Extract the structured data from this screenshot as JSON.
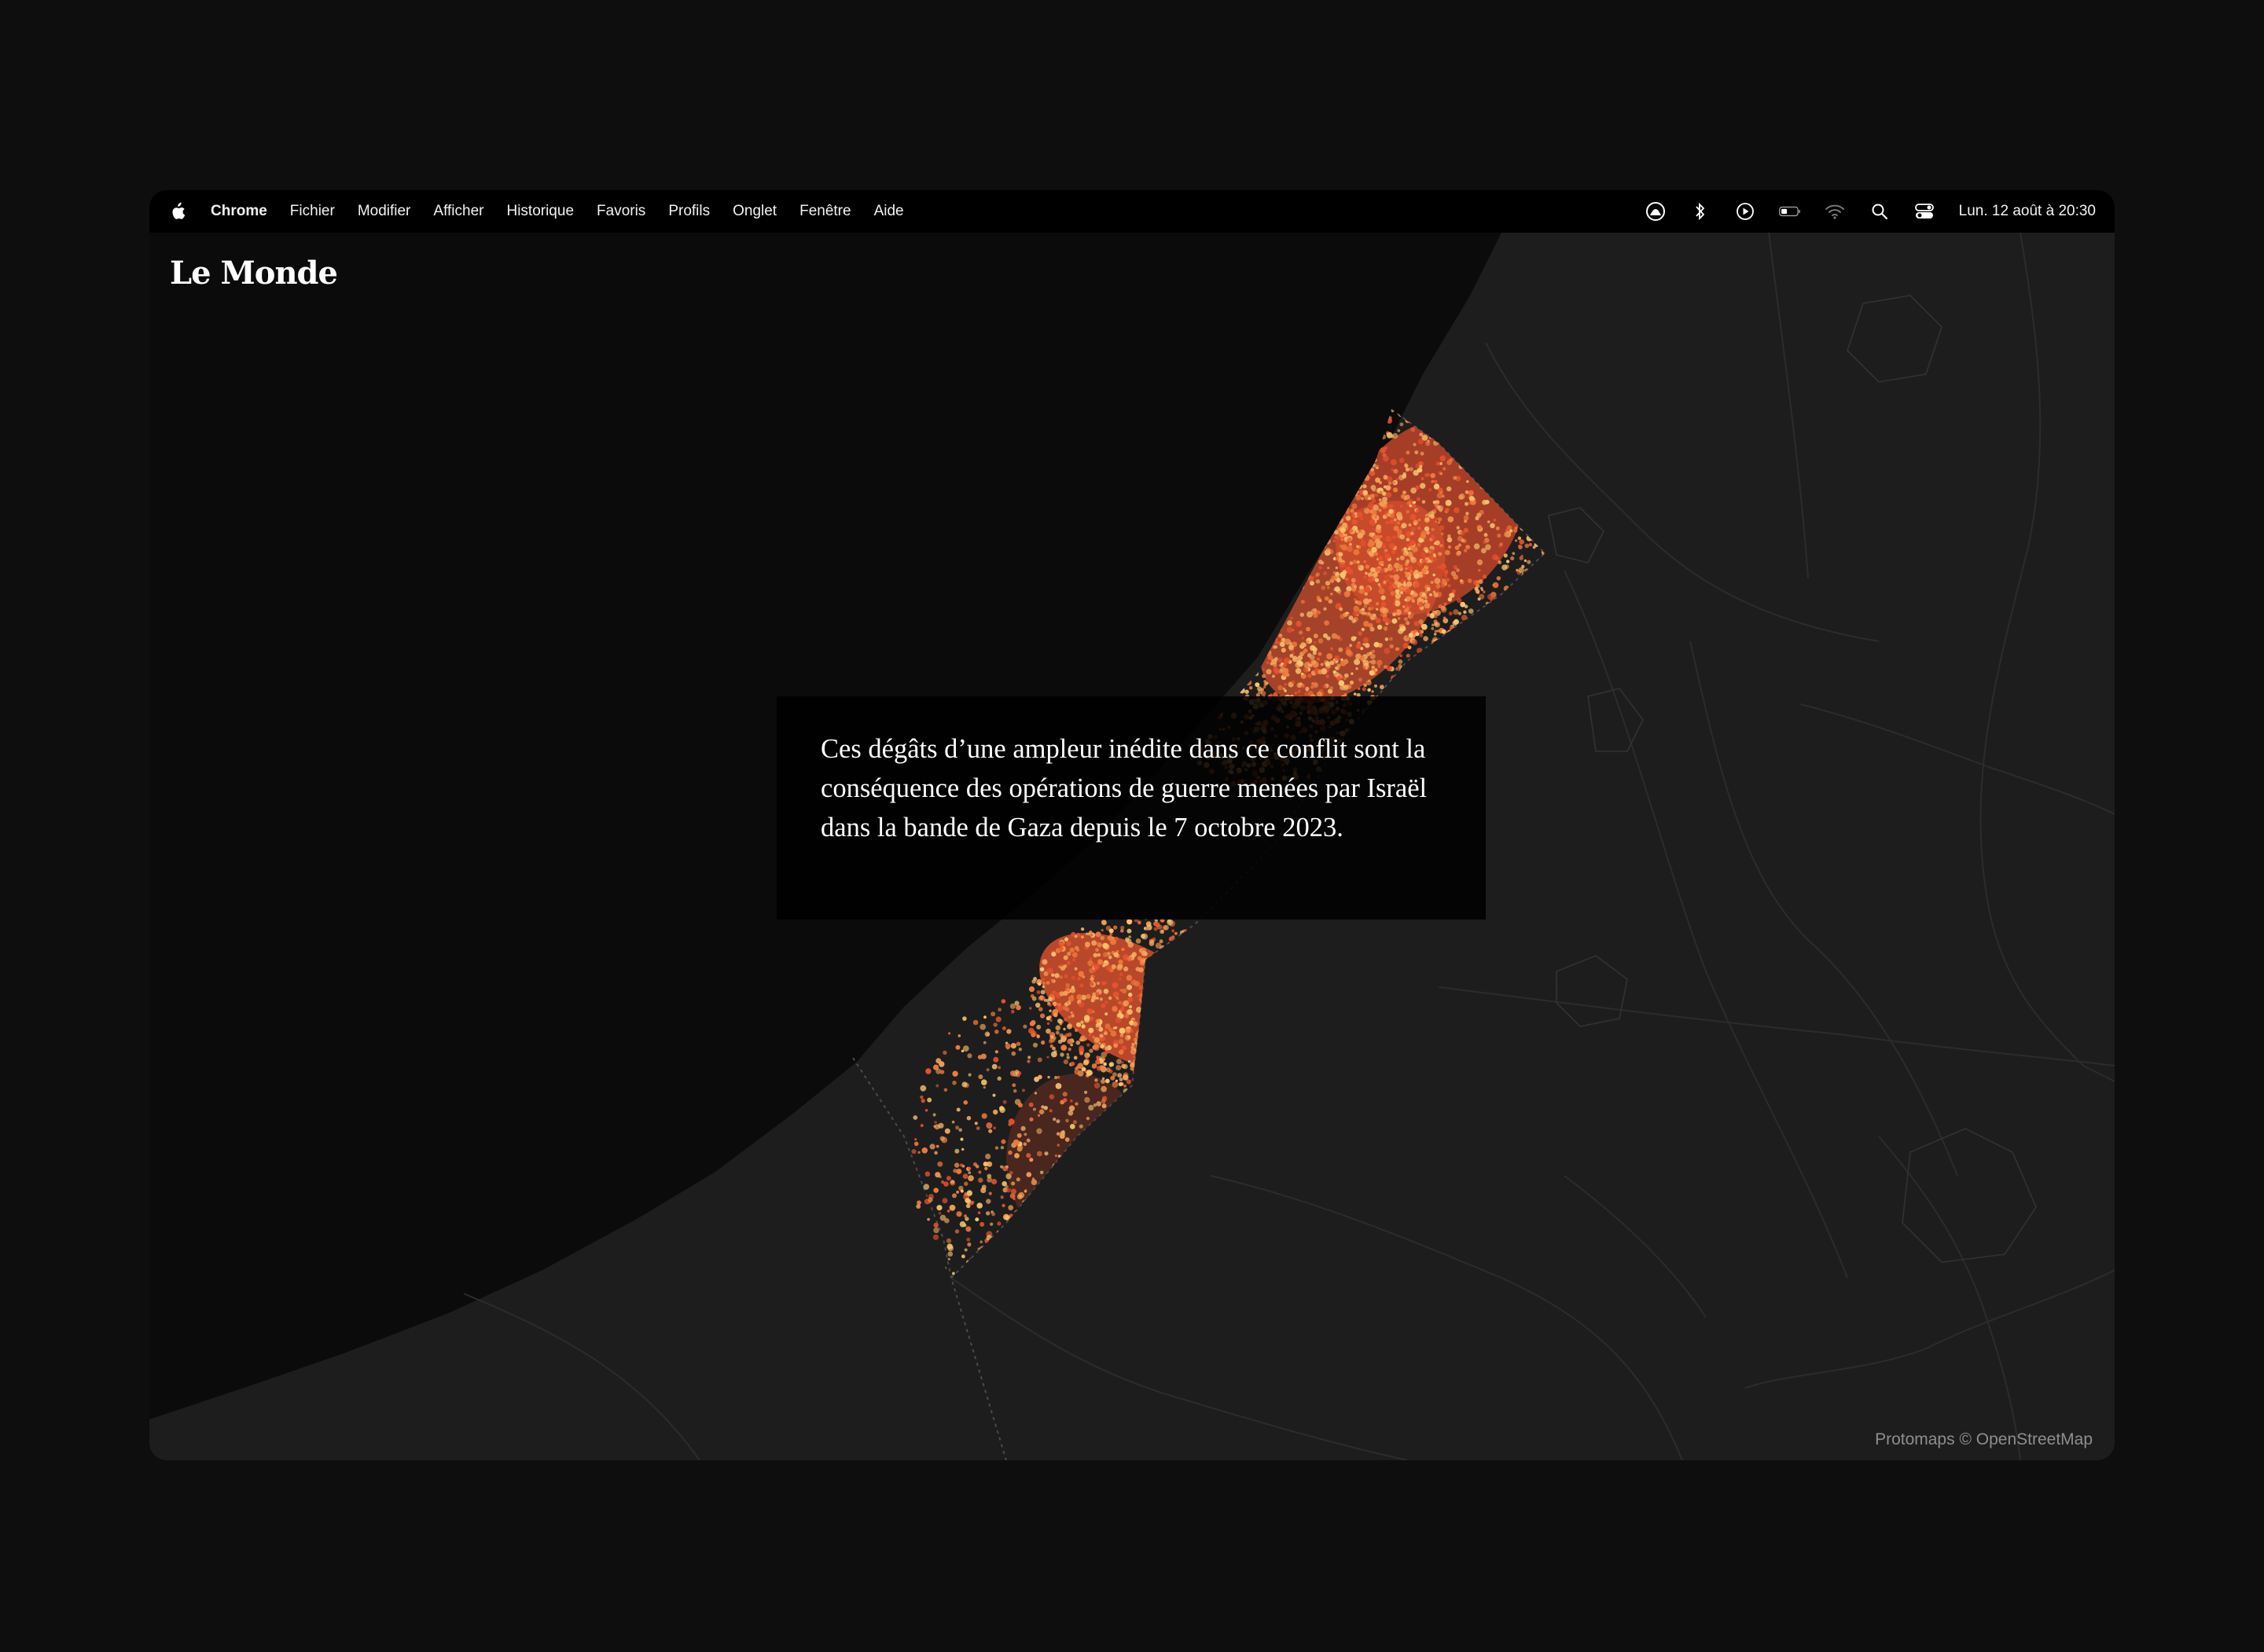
{
  "menubar": {
    "app_name": "Chrome",
    "items": [
      "Fichier",
      "Modifier",
      "Afficher",
      "Historique",
      "Favoris",
      "Profils",
      "Onglet",
      "Fenêtre",
      "Aide"
    ],
    "status_icons": [
      "focus-icon",
      "bluetooth-icon",
      "play-icon",
      "battery-icon",
      "wifi-icon",
      "search-icon",
      "control-center-icon"
    ],
    "clock": "Lun. 12 août à  20:30"
  },
  "page": {
    "logo": "Le Monde",
    "caption": "Ces dégâts d’une ampleur inédite dans ce conflit sont la conséquence des opérations de guerre menées par Israël dans la bande de Gaza depuis le 7 octobre 2023.",
    "attribution": "Protomaps © OpenStreetMap"
  },
  "map": {
    "sea_color": "#0b0b0b",
    "land_color": "#1d1d1d",
    "damage_colors": [
      "#e8522f",
      "#f07a3c",
      "#f4a25a",
      "#f8c470"
    ]
  }
}
